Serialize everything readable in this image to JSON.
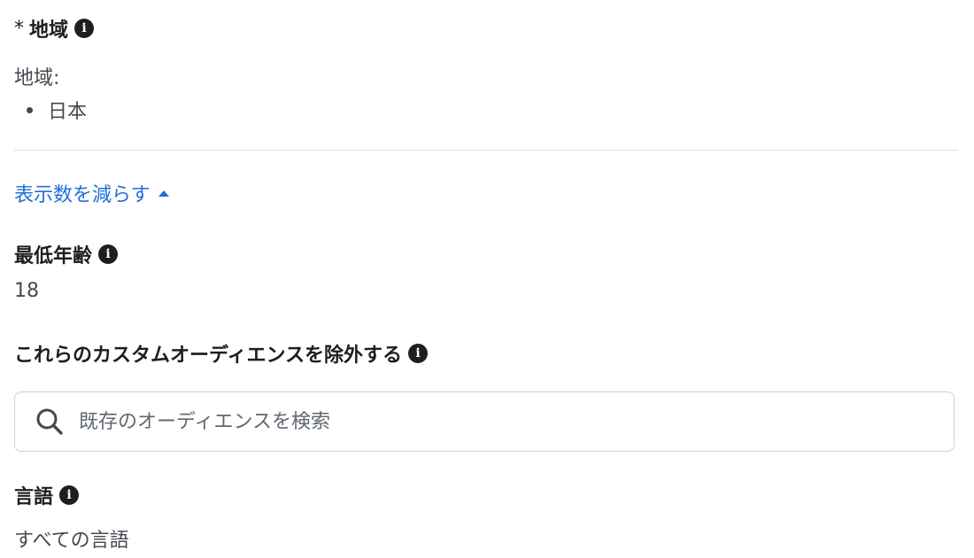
{
  "region": {
    "required_mark": "*",
    "title": "地域",
    "label": "地域:",
    "items": [
      "日本"
    ]
  },
  "toggle": {
    "label": "表示数を減らす"
  },
  "min_age": {
    "title": "最低年齢",
    "value": "18"
  },
  "exclude_audiences": {
    "title": "これらのカスタムオーディエンスを除外する",
    "search_placeholder": "既存のオーディエンスを検索"
  },
  "language": {
    "title": "言語",
    "value": "すべての言語"
  },
  "icons": {
    "info": "info-icon",
    "search": "search-icon",
    "caret": "caret-up-icon"
  },
  "colors": {
    "link": "#216fdb",
    "text": "#1c1e21",
    "muted": "#444950",
    "divider": "#dadde1"
  }
}
